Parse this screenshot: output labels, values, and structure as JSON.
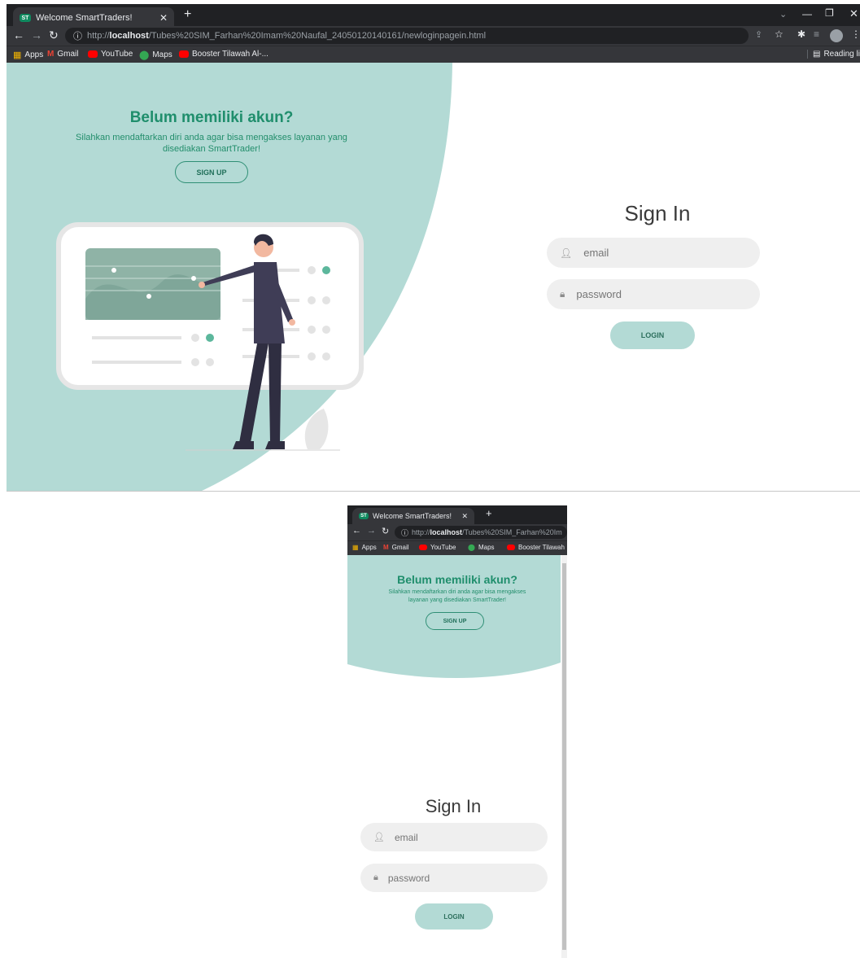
{
  "browser": {
    "tab_title": "Welcome SmartTraders!",
    "favicon_text": "ST",
    "url_prefix": "http://",
    "url_host": "localhost",
    "url_path": "/Tubes%20SIM_Farhan%20Imam%20Naufal_24050120140161/newloginpagein.html",
    "url_path_short": "/Tubes%20SIM_Farhan%20Im",
    "bookmarks": [
      "Apps",
      "Gmail",
      "YouTube",
      "Maps",
      "Booster Tilawah Al-...",
      "Booster Tilawah"
    ],
    "reading_list": "Reading list"
  },
  "signup_panel": {
    "title": "Belum memiliki akun?",
    "line1": "Silahkan mendaftarkan diri anda agar bisa mengakses layanan yang",
    "line2": "disediakan SmartTrader!",
    "mobile_line1": "Silahkan mendaftarkan diri anda agar bisa mengakses",
    "mobile_line2": "layanan yang disediakan SmartTrader!",
    "button": "SIGN UP"
  },
  "signin": {
    "title": "Sign In",
    "email_placeholder": "email",
    "password_placeholder": "password",
    "button": "LOGIN"
  },
  "colors": {
    "mint": "#b3dad5",
    "teal_text": "#1f8e6c",
    "chrome_dark": "#202124"
  }
}
